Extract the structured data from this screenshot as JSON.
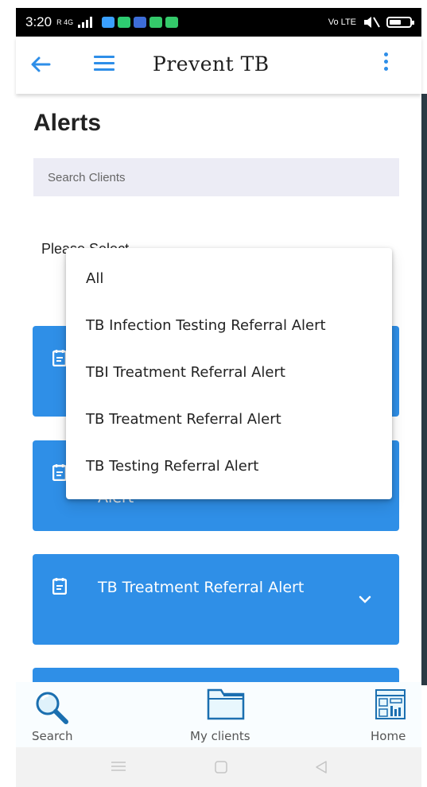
{
  "status_bar": {
    "time": "3:20",
    "signal_text": "R 4G",
    "network_text": "Vo LTE",
    "notification_colors": [
      "#3aa0ff",
      "#2ecc71",
      "#3d6dd8",
      "#34c96a",
      "#34c96a"
    ]
  },
  "app_bar": {
    "title": "Prevent TB",
    "accent_color": "#2e8ee8"
  },
  "page": {
    "title": "Alerts",
    "search_placeholder": "Search Clients",
    "select_label": "Please Select"
  },
  "cards": [
    {
      "label": "",
      "icon": "calendar-icon"
    },
    {
      "label": "Alert",
      "icon": "calendar-icon"
    },
    {
      "label": "TB Treatment Referral Alert",
      "icon": "calendar-icon"
    },
    {
      "label": "",
      "icon": "calendar-icon"
    }
  ],
  "card_color": "#2f8fe7",
  "dropdown": {
    "options": [
      "All",
      "TB Infection Testing Referral Alert",
      "TBI Treatment Referral Alert",
      "TB Treatment Referral Alert",
      "TB Testing Referral Alert"
    ]
  },
  "bottom_nav": {
    "items": [
      {
        "label": "Search",
        "icon": "magnifier-icon"
      },
      {
        "label": "My clients",
        "icon": "folder-icon"
      },
      {
        "label": "Home",
        "icon": "dashboard-icon"
      }
    ]
  }
}
